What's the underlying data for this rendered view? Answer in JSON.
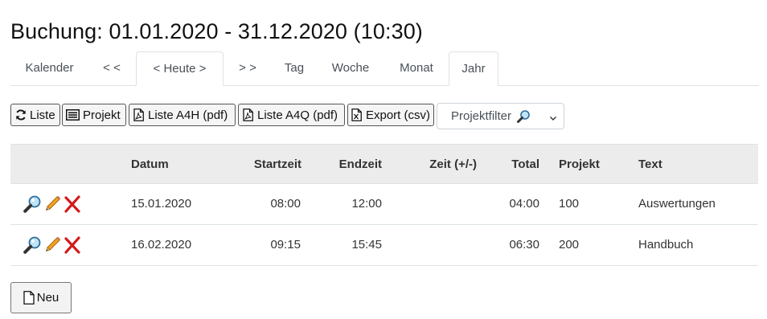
{
  "title": "Buchung: 01.01.2020 - 31.12.2020 (10:30)",
  "tabs": [
    {
      "label": "Kalender"
    },
    {
      "label": "< <"
    },
    {
      "label": "< Heute >"
    },
    {
      "label": "> >"
    },
    {
      "label": "Tag"
    },
    {
      "label": "Woche"
    },
    {
      "label": "Monat"
    },
    {
      "label": "Jahr"
    }
  ],
  "active_tab": "< Heute >",
  "toolbar": {
    "liste": "Liste",
    "projekt": "Projekt",
    "liste_a4h": "Liste A4H (pdf)",
    "liste_a4q": "Liste A4Q (pdf)",
    "export": "Export (csv)",
    "projektfilter": "Projektfilter"
  },
  "table": {
    "headers": {
      "datum": "Datum",
      "startzeit": "Startzeit",
      "endzeit": "Endzeit",
      "zeit": "Zeit (+/-)",
      "total": "Total",
      "projekt": "Projekt",
      "text": "Text"
    },
    "rows": [
      {
        "datum": "15.01.2020",
        "startzeit": "08:00",
        "endzeit": "12:00",
        "zeit": "",
        "total": "04:00",
        "projekt": "100",
        "text": "Auswertungen"
      },
      {
        "datum": "16.02.2020",
        "startzeit": "09:15",
        "endzeit": "15:45",
        "zeit": "",
        "total": "06:30",
        "projekt": "200",
        "text": "Handbuch"
      }
    ]
  },
  "new_button": "Neu",
  "icons": {
    "refresh": "refresh-icon",
    "list": "list-icon",
    "pdf": "pdf-file-icon",
    "excel": "excel-file-icon",
    "search": "magnifier-icon",
    "edit": "pencil-icon",
    "delete": "red-x-icon",
    "file": "file-icon"
  }
}
